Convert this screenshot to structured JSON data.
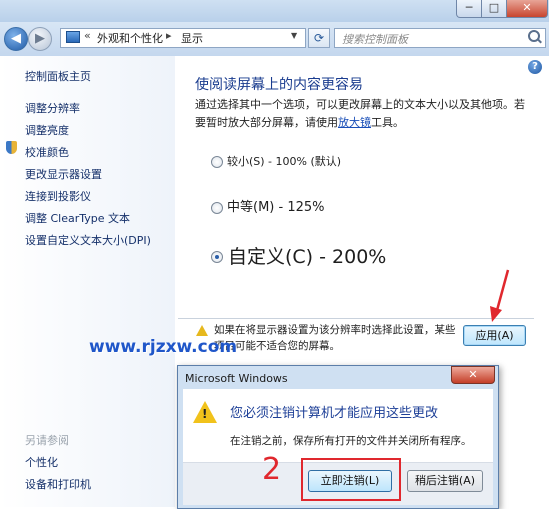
{
  "window": {
    "minimize_icon": "minimize-icon",
    "maximize_icon": "maximize-icon",
    "close_icon": "close-icon"
  },
  "navigation": {
    "back_icon": "back-arrow-icon",
    "forward_icon": "forward-arrow-icon",
    "address": {
      "chevron": "«",
      "crumbs": [
        "外观和个性化",
        "显示"
      ],
      "separator": "▸",
      "dropdown": "▼"
    },
    "refresh_icon": "refresh-icon",
    "search_placeholder": "搜索控制面板"
  },
  "sidebar": {
    "home": "控制面板主页",
    "items": [
      "调整分辨率",
      "调整亮度",
      "校准颜色",
      "更改显示器设置",
      "连接到投影仪",
      "调整 ClearType 文本",
      "设置自定义文本大小(DPI)"
    ],
    "see_also_title": "另请参阅",
    "see_also": [
      "个性化",
      "设备和打印机"
    ]
  },
  "main": {
    "title": "使阅读屏幕上的内容更容易",
    "description_prefix": "通过选择其中一个选项，可以更改屏幕上的文本大小以及其他项。若要暂时放大部分屏幕，请使用",
    "magnifier_link": "放大镜",
    "description_suffix": "工具。",
    "options": [
      {
        "label": "较小(S) - 100% (默认)",
        "selected": false
      },
      {
        "label": "中等(M) - 125%",
        "selected": false
      },
      {
        "label": "自定义(C) - 200%",
        "selected": true
      }
    ],
    "warning": "如果在将显示器设置为该分辨率时选择此设置，某些项目可能不适合您的屏幕。",
    "apply_button": "应用(A)"
  },
  "dialog": {
    "title": "Microsoft Windows",
    "heading": "您必须注销计算机才能应用这些更改",
    "message": "在注销之前，保存所有打开的文件并关闭所有程序。",
    "logoff_button": "立即注销(L)",
    "later_button": "稍后注销(A)"
  },
  "annotations": {
    "watermark": "www.rjzxw.com",
    "step_number": "2",
    "highlight_color": "#e0282e"
  },
  "colors": {
    "accent": "#1a3c8f",
    "link": "#15306a",
    "watermark": "#1f56c9"
  }
}
